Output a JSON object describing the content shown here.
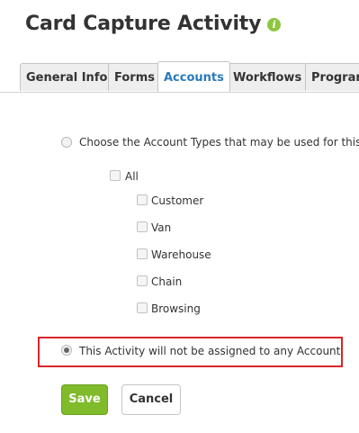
{
  "page": {
    "title": "Card Capture Activity",
    "info_icon": "info-icon"
  },
  "tabs": [
    {
      "label": "General Info",
      "active": false
    },
    {
      "label": "Forms",
      "active": false
    },
    {
      "label": "Accounts",
      "active": true
    },
    {
      "label": "Workflows",
      "active": false
    },
    {
      "label": "Program",
      "active": false
    }
  ],
  "accounts": {
    "option_choose_types": {
      "label": "Choose the Account Types that may be used for this A",
      "selected": false
    },
    "all_checkbox": {
      "label": "All",
      "checked": false
    },
    "account_types": [
      {
        "label": "Customer",
        "checked": false
      },
      {
        "label": "Van",
        "checked": false
      },
      {
        "label": "Warehouse",
        "checked": false
      },
      {
        "label": "Chain",
        "checked": false
      },
      {
        "label": "Browsing",
        "checked": false
      }
    ],
    "option_no_account": {
      "label": "This Activity will not be assigned to any Account",
      "selected": true
    }
  },
  "buttons": {
    "save_label": "Save",
    "cancel_label": "Cancel"
  },
  "colors": {
    "accent_green": "#7fbb2a",
    "active_tab_text": "#2a7ab8",
    "highlight_red": "#d9252b",
    "info_icon_green": "#8dc63f"
  }
}
